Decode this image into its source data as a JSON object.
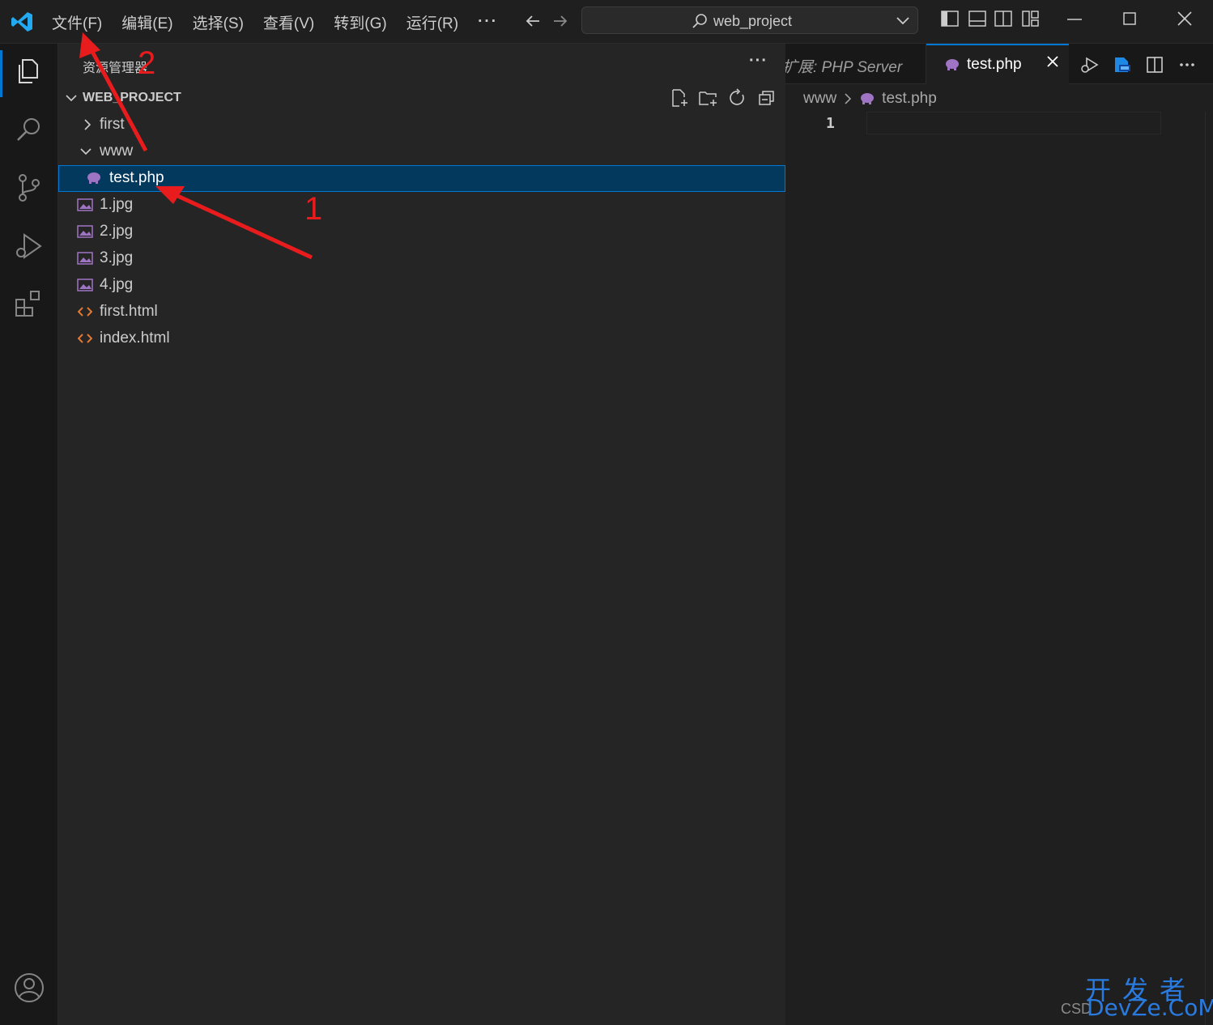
{
  "menu": {
    "file": "文件(F)",
    "edit": "编辑(E)",
    "selection": "选择(S)",
    "view": "查看(V)",
    "goto": "转到(G)",
    "run": "运行(R)",
    "more": "···"
  },
  "search": {
    "value": "web_project"
  },
  "sidebar": {
    "title": "资源管理器",
    "more": "···",
    "project": "WEB_PROJECT",
    "tree": [
      {
        "label": "first",
        "kind": "folder-collapsed"
      },
      {
        "label": "www",
        "kind": "folder-expanded"
      },
      {
        "label": "test.php",
        "kind": "php",
        "selected": true
      },
      {
        "label": "1.jpg",
        "kind": "image"
      },
      {
        "label": "2.jpg",
        "kind": "image"
      },
      {
        "label": "3.jpg",
        "kind": "image"
      },
      {
        "label": "4.jpg",
        "kind": "image"
      },
      {
        "label": "first.html",
        "kind": "html"
      },
      {
        "label": "index.html",
        "kind": "html"
      }
    ]
  },
  "editor": {
    "tabs": [
      {
        "label": "扩展: PHP Server",
        "active": false
      },
      {
        "label": "test.php",
        "active": true
      }
    ],
    "breadcrumb": [
      "www",
      "test.php"
    ],
    "line_numbers": [
      "1"
    ]
  },
  "annotations": {
    "one": "1",
    "two": "2"
  },
  "watermark": {
    "csdn": "CSD",
    "cn": "开发者",
    "en": "DevZe.CoM"
  },
  "colors": {
    "accent": "#0078d4",
    "selection": "#04395e",
    "php": "#a074c4",
    "html": "#e37933",
    "arrow": "#e81c1c"
  }
}
